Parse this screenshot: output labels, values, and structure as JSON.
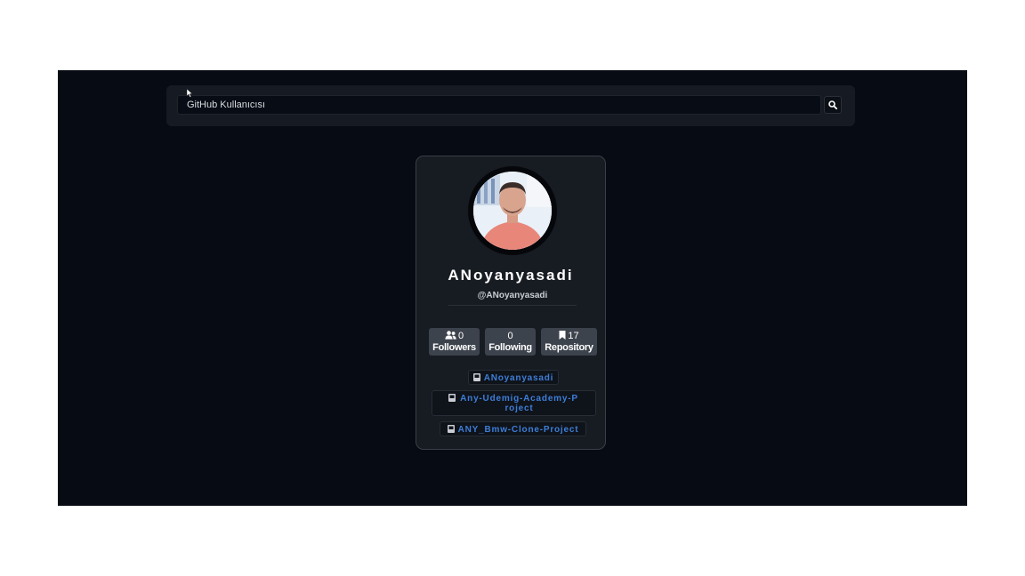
{
  "search": {
    "placeholder": "GitHub Kullanıcısı",
    "button_icon": "search-icon"
  },
  "profile": {
    "name": "ANoyanyasadi",
    "handle": "@ANoyanyasadi",
    "avatar_icon": "user-avatar"
  },
  "stats": {
    "followers": {
      "count": "0",
      "label": "Followers",
      "icon": "users-icon"
    },
    "following": {
      "count": "0",
      "label": "Following"
    },
    "repository": {
      "count": "17",
      "label": "Repository",
      "icon": "bookmark-icon"
    }
  },
  "repos": [
    {
      "name": "ANoyanyasadi",
      "icon": "repo-icon"
    },
    {
      "name": "Any-Udemig-Academy-Project",
      "icon": "repo-icon"
    },
    {
      "name": "ANY_Bmw-Clone-Project",
      "icon": "repo-icon"
    }
  ],
  "colors": {
    "stage_bg": "#070b13",
    "card_bg": "#171b22",
    "stat_bg": "#3d434c",
    "repo_link": "#3d7ed8"
  }
}
